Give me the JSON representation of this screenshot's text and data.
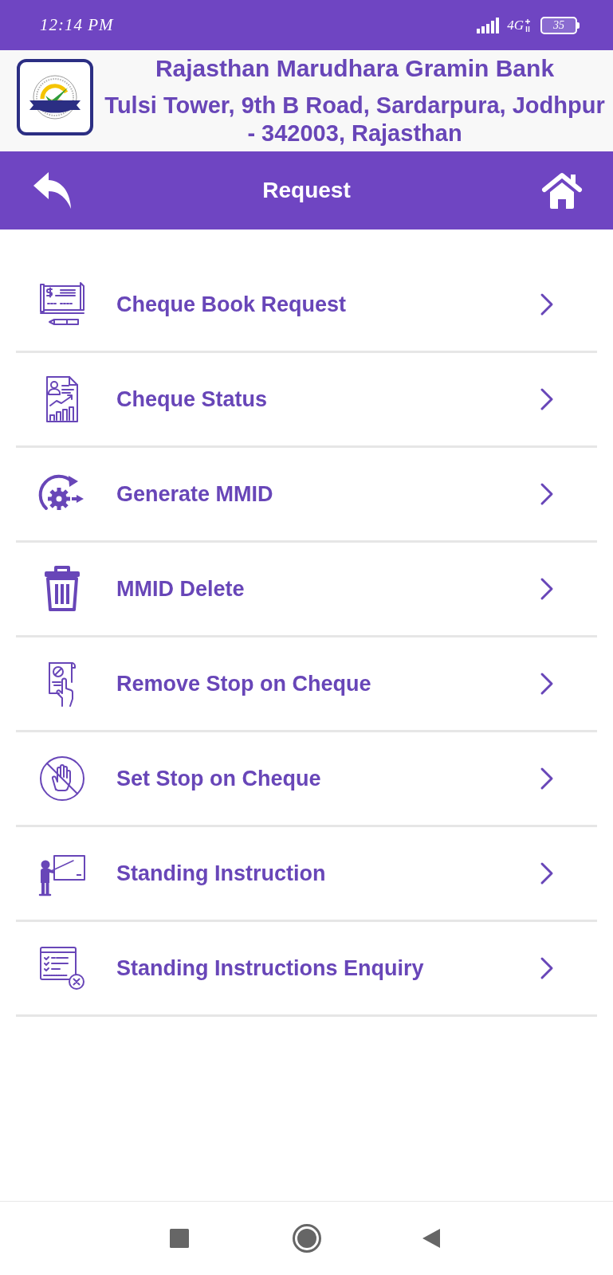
{
  "status_bar": {
    "time": "12:14 PM",
    "network": "4G",
    "battery": "35"
  },
  "header": {
    "bank_name": "Rajasthan Marudhara Gramin Bank",
    "address": "Tulsi Tower, 9th B Road, Sardarpura, Jodhpur - 342003, Rajasthan"
  },
  "nav_bar": {
    "title": "Request"
  },
  "menu": [
    {
      "kind": "cheque-book",
      "label": "Cheque Book Request"
    },
    {
      "kind": "status-report",
      "label": "Cheque Status"
    },
    {
      "kind": "gear-arrow",
      "label": "Generate MMID"
    },
    {
      "kind": "trash",
      "label": "MMID Delete"
    },
    {
      "kind": "hand-document",
      "label": "Remove Stop on Cheque"
    },
    {
      "kind": "stop-hand",
      "label": "Set Stop on Cheque"
    },
    {
      "kind": "teacher",
      "label": "Standing Instruction"
    },
    {
      "kind": "checklist-cancel",
      "label": "Standing Instructions Enquiry"
    }
  ]
}
